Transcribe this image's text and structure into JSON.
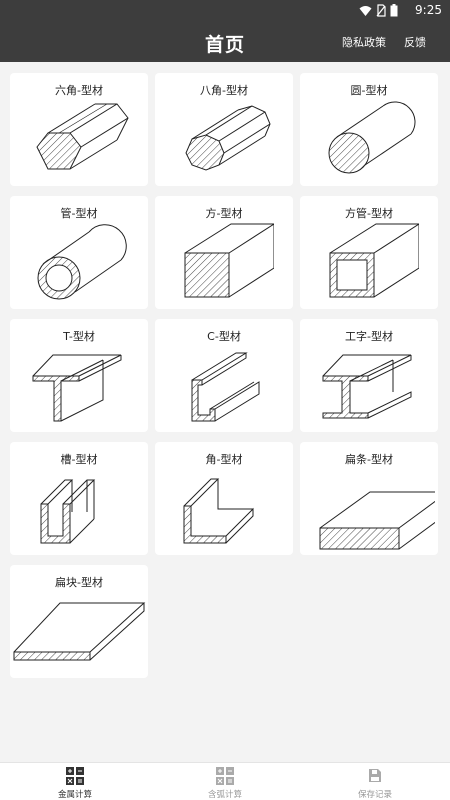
{
  "status_bar": {
    "time": "9:25"
  },
  "header": {
    "title": "首页",
    "privacy_label": "隐私政策",
    "feedback_label": "反馈"
  },
  "profiles": [
    {
      "label": "六角-型材",
      "shape": "hex-bar-icon"
    },
    {
      "label": "八角-型材",
      "shape": "octagon-bar-icon"
    },
    {
      "label": "圆-型材",
      "shape": "round-bar-icon"
    },
    {
      "label": "管-型材",
      "shape": "tube-icon"
    },
    {
      "label": "方-型材",
      "shape": "square-bar-icon"
    },
    {
      "label": "方管-型材",
      "shape": "square-tube-icon"
    },
    {
      "label": "T-型材",
      "shape": "t-beam-icon"
    },
    {
      "label": "C-型材",
      "shape": "c-channel-icon"
    },
    {
      "label": "工字-型材",
      "shape": "i-beam-icon"
    },
    {
      "label": "槽-型材",
      "shape": "u-channel-icon"
    },
    {
      "label": "角-型材",
      "shape": "angle-icon"
    },
    {
      "label": "扁条-型材",
      "shape": "flat-bar-icon"
    },
    {
      "label": "扁块-型材",
      "shape": "flat-plate-icon"
    }
  ],
  "bottom_nav": [
    {
      "label": "金属计算",
      "icon": "calculator-icon",
      "active": true
    },
    {
      "label": "含弧计算",
      "icon": "arc-calculator-icon",
      "active": false
    },
    {
      "label": "保存记录",
      "icon": "save-record-icon",
      "active": false
    }
  ]
}
